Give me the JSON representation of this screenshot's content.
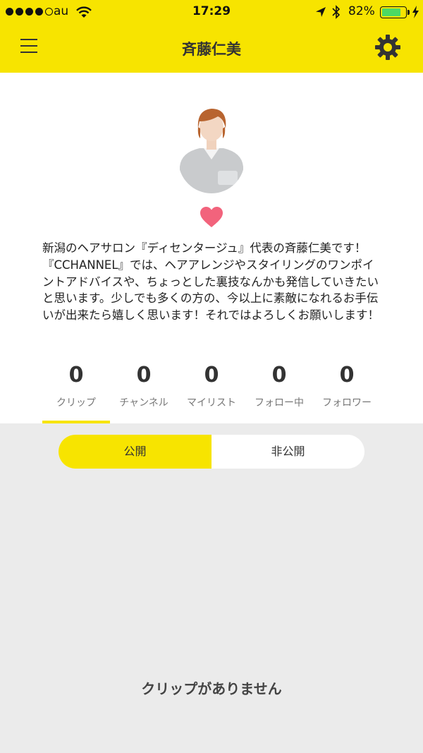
{
  "status_bar": {
    "carrier": "au",
    "time": "17:29",
    "battery_percent": "82%",
    "battery_level": 0.82
  },
  "nav": {
    "title": "斉藤仁美",
    "menu_icon": "hamburger-menu-icon",
    "settings_icon": "gear-icon"
  },
  "profile": {
    "avatar_icon": "profile-photo",
    "heart_icon": "heart-icon",
    "heart_color": "#f2637c",
    "bio": "新潟のヘアサロン『ディセンタージュ』代表の斉藤仁美です！『CCHANNEL』では、ヘアアレンジやスタイリングのワンポイントアドバイスや、ちょっとした裏技なんかも発信していきたいと思います。少しでも多くの方の、今以上に素敵になれるお手伝いが出来たら嬉しく思います！それではよろしくお願いします！"
  },
  "stats": [
    {
      "value": "0",
      "label": "クリップ"
    },
    {
      "value": "0",
      "label": "チャンネル"
    },
    {
      "value": "0",
      "label": "マイリスト"
    },
    {
      "value": "0",
      "label": "フォロー中"
    },
    {
      "value": "0",
      "label": "フォロワー"
    }
  ],
  "visibility_toggle": {
    "public_label": "公開",
    "private_label": "非公開",
    "selected": "公開"
  },
  "empty_message": "クリップがありません",
  "colors": {
    "accent": "#f7e400",
    "background": "#ebebeb"
  }
}
